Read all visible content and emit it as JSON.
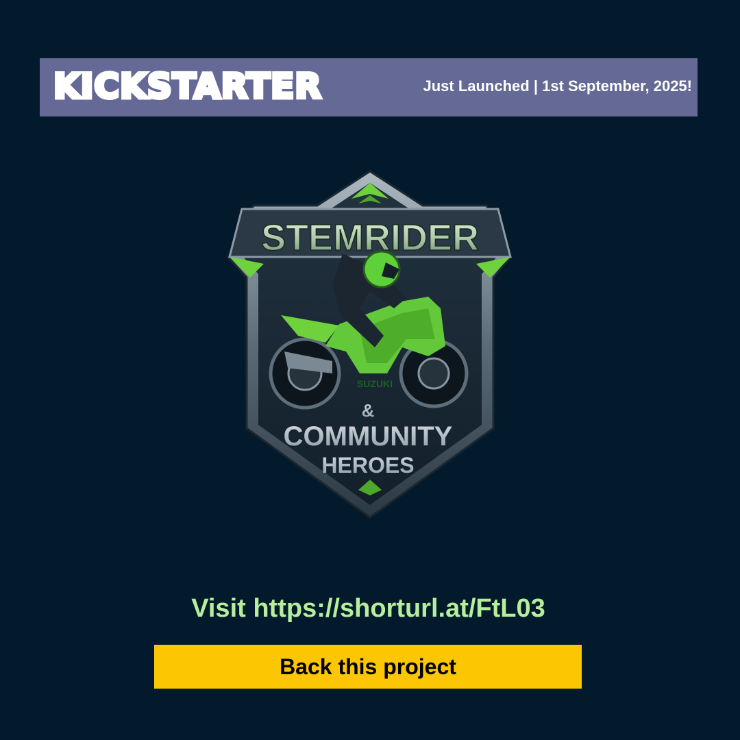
{
  "header": {
    "brand": "KICKSTARTER",
    "announcement": "Just Launched | 1st September, 2025!"
  },
  "emblem": {
    "title": "STEMRIDER",
    "ampersand": "&",
    "subtitle_1": "COMMUNITY",
    "subtitle_2": "HEROES",
    "bike_brand": "SUZUKI"
  },
  "visit": {
    "text": "Visit https://shorturl.at/FtL03"
  },
  "cta": {
    "label": "Back this project"
  },
  "colors": {
    "background": "#031a2c",
    "banner": "#646996",
    "accent_green": "#6fd23c",
    "visit_text": "#b6ef9c",
    "button": "#fdc603"
  }
}
